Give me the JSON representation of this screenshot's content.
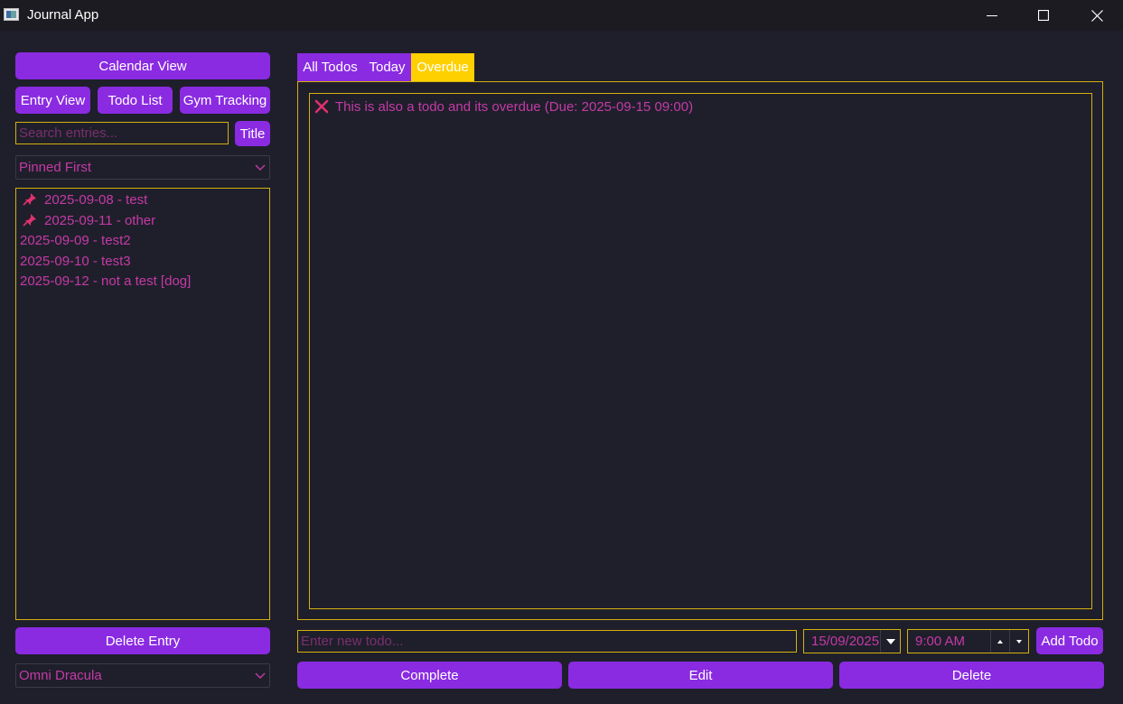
{
  "window": {
    "title": "Journal App"
  },
  "sidebar": {
    "calendar_view": "Calendar View",
    "entry_view": "Entry View",
    "todo_list": "Todo List",
    "gym_tracking": "Gym Tracking",
    "search_placeholder": "Search entries...",
    "search_mode": "Title",
    "sort_selected": "Pinned First",
    "entries": [
      {
        "label": "2025-09-08 - test",
        "pinned": true
      },
      {
        "label": "2025-09-11 - other",
        "pinned": true
      },
      {
        "label": "2025-09-09 - test2",
        "pinned": false
      },
      {
        "label": "2025-09-10 - test3",
        "pinned": false
      },
      {
        "label": "2025-09-12 - not a test [dog]",
        "pinned": false
      }
    ],
    "delete_entry": "Delete Entry",
    "theme_selected": "Omni Dracula"
  },
  "main": {
    "tabs": [
      {
        "label": "All Todos",
        "active": false
      },
      {
        "label": "Today",
        "active": false
      },
      {
        "label": "Overdue",
        "active": true
      }
    ],
    "todos": [
      {
        "text": "This is also a todo and its overdue (Due: 2025-09-15 09:00)",
        "icon": "cross-mark-icon"
      }
    ],
    "new_todo_placeholder": "Enter new todo...",
    "due_date": "15/09/2025",
    "due_time": "9:00 AM",
    "add_todo": "Add Todo",
    "complete": "Complete",
    "edit": "Edit",
    "delete": "Delete"
  },
  "colors": {
    "background": "#1f1f2b",
    "accent": "#8a2be2",
    "border": "#d4b00c",
    "text": "#c43aa6",
    "active_tab": "#ffd000"
  }
}
